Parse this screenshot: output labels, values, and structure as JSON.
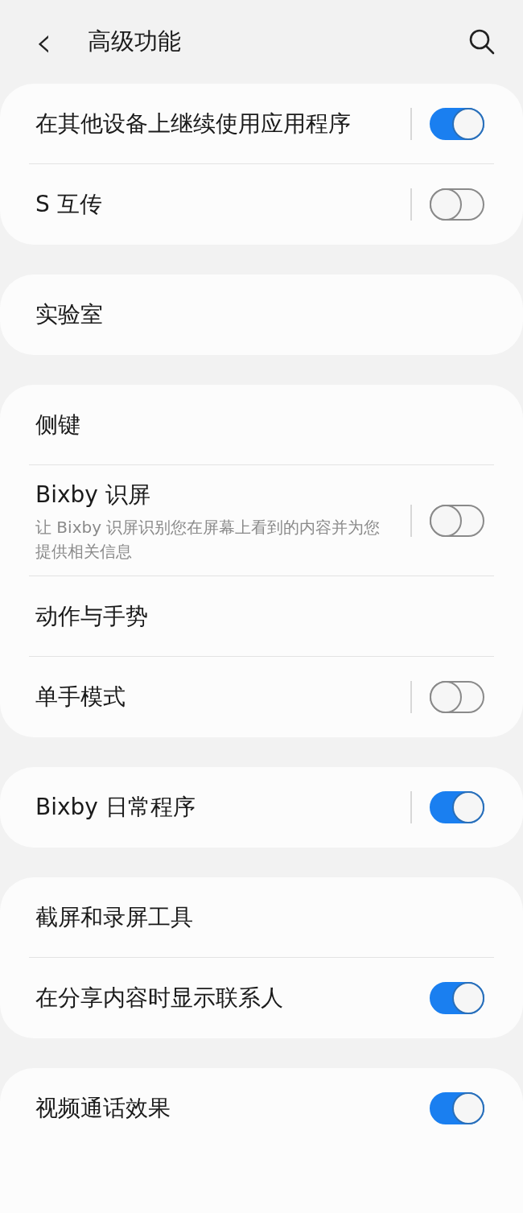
{
  "header": {
    "back": "‹",
    "title": "高级功能"
  },
  "groups": [
    {
      "items": [
        {
          "kind": "toggle",
          "title": "在其他设备上继续使用应用程序",
          "on": true
        },
        {
          "kind": "toggle",
          "title": "S 互传",
          "on": false
        }
      ]
    },
    {
      "items": [
        {
          "kind": "link",
          "title": "实验室"
        }
      ]
    },
    {
      "items": [
        {
          "kind": "link",
          "title": "侧键"
        },
        {
          "kind": "toggle",
          "title": "Bixby 识屏",
          "subtitle": "让 Bixby 识屏识别您在屏幕上看到的内容并为您提供相关信息",
          "on": false
        },
        {
          "kind": "link",
          "title": "动作与手势"
        },
        {
          "kind": "toggle",
          "title": "单手模式",
          "on": false
        }
      ]
    },
    {
      "items": [
        {
          "kind": "toggle",
          "title": "Bixby 日常程序",
          "on": true
        }
      ]
    },
    {
      "items": [
        {
          "kind": "link",
          "title": "截屏和录屏工具"
        },
        {
          "kind": "switch",
          "title": "在分享内容时显示联系人",
          "on": true
        }
      ]
    },
    {
      "items": [
        {
          "kind": "switch",
          "title": "视频通话效果",
          "on": true
        }
      ]
    }
  ]
}
